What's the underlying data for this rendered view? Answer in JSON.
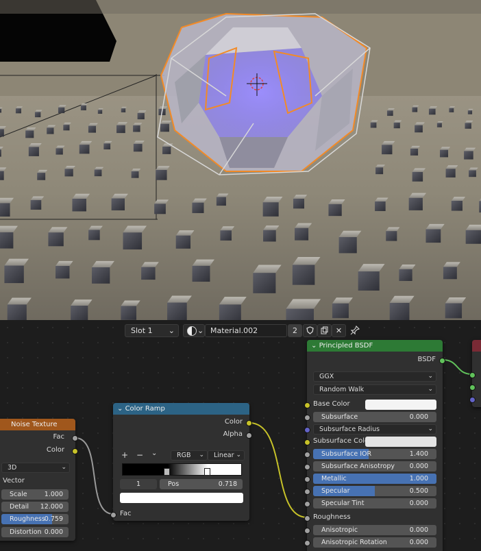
{
  "colors": {
    "accent": "#4772b3",
    "shader_header": "#2d7a35",
    "converter_header": "#2c6385",
    "texture_header": "#a0571c",
    "sock_yellow": "#c7c229",
    "sock_grey": "#a1a1a1",
    "sock_green": "#61c25b",
    "sock_purple": "#6363c7"
  },
  "header": {
    "slot": "Slot 1",
    "material": "Material.002",
    "users": "2",
    "shield_icon": "shield-icon",
    "copy_icon": "copy-icon",
    "close_icon": "close-icon",
    "pin_icon": "pin-icon"
  },
  "noise": {
    "title": "Noise Texture",
    "out_fac": "Fac",
    "out_color": "Color",
    "dim": "3D",
    "vector": "Vector",
    "scale_l": "Scale",
    "scale_v": "1.000",
    "detail_l": "Detail",
    "detail_v": "12.000",
    "rough_l": "Roughness",
    "rough_v": "0.759",
    "rough_fill": 0.759,
    "dist_l": "Distortion",
    "dist_v": "0.000"
  },
  "ramp": {
    "title": "Color Ramp",
    "out_color": "Color",
    "out_alpha": "Alpha",
    "plus": "+",
    "minus": "−",
    "mode": "RGB",
    "interp": "Linear",
    "index": "1",
    "pos_l": "Pos",
    "pos_v": "0.718",
    "in_fac": "Fac"
  },
  "bsdf": {
    "title": "Principled BSDF",
    "out": "BSDF",
    "dist": "GGX",
    "sss": "Random Walk",
    "base_color": "Base Color",
    "subsurface": "Subsurface",
    "subsurface_v": "0.000",
    "sss_radius": "Subsurface Radius",
    "sss_color": "Subsurface Color",
    "sss_ior": "Subsurface IOR",
    "sss_ior_v": "1.400",
    "sss_ior_fill": 0.45,
    "sss_aniso": "Subsurface Anisotropy",
    "sss_aniso_v": "0.000",
    "metallic": "Metallic",
    "metallic_v": "1.000",
    "metallic_fill": 1.0,
    "specular": "Specular",
    "specular_v": "0.500",
    "specular_fill": 0.5,
    "spec_tint": "Specular Tint",
    "spec_tint_v": "0.000",
    "roughness": "Roughness",
    "aniso": "Anisotropic",
    "aniso_v": "0.000",
    "aniso_rot": "Anisotropic Rotation",
    "aniso_rot_v": "0.000"
  }
}
